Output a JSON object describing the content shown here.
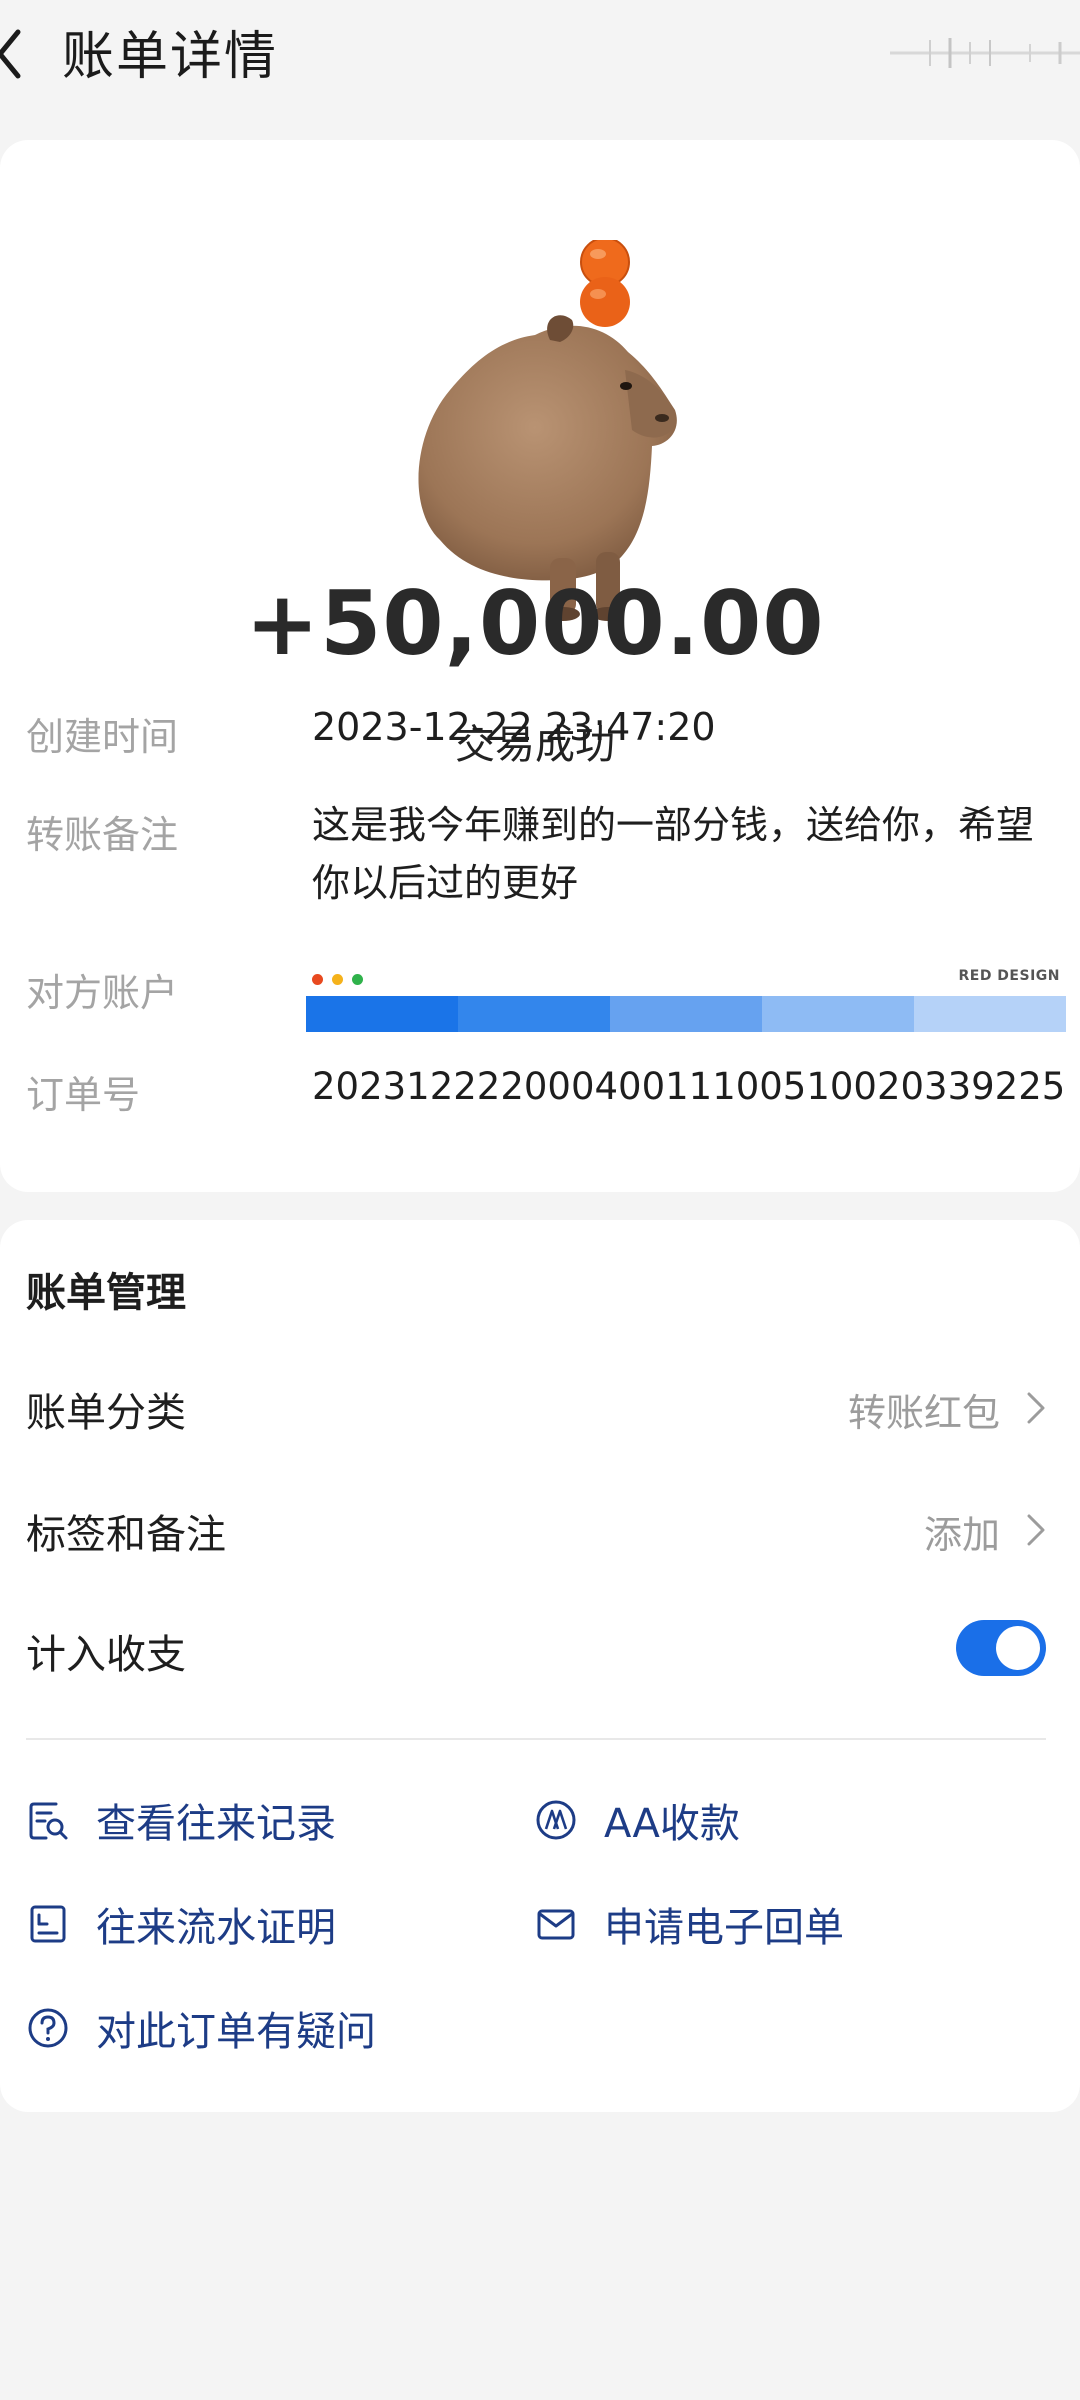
{
  "header": {
    "title": "账单详情",
    "back_icon": "chevron-left-icon"
  },
  "summary": {
    "amount": "+50,000.00",
    "status": "交易成功",
    "fields": [
      {
        "label": "创建时间",
        "value": "2023-12-22 23:47:20"
      },
      {
        "label": "转账备注",
        "value": "这是我今年赚到的一部分钱，送给你，希望你以后过的更好"
      },
      {
        "label": "对方账户",
        "value": ""
      },
      {
        "label": "订单号",
        "value": "20231222200040011100510020339225"
      }
    ],
    "account_banner": {
      "brand": "RED DESIGN",
      "dot_colors": [
        "#e8491f",
        "#f5b21b",
        "#2fb24b"
      ],
      "segment_colors": [
        "#1a74e8",
        "#3386ec",
        "#66a2f0",
        "#8ebbf4",
        "#b5d2f8"
      ]
    }
  },
  "management": {
    "title": "账单管理",
    "rows": [
      {
        "label": "账单分类",
        "value": "转账红包"
      },
      {
        "label": "标签和备注",
        "value": "添加"
      },
      {
        "label": "计入收支",
        "toggle_on": true
      }
    ],
    "actions": [
      {
        "label": "查看往来记录",
        "icon": "record-search-icon"
      },
      {
        "label": "AA收款",
        "icon": "aa-collect-icon"
      },
      {
        "label": "往来流水证明",
        "icon": "statement-icon"
      },
      {
        "label": "申请电子回单",
        "icon": "mail-icon"
      },
      {
        "label": "对此订单有疑问",
        "icon": "question-icon"
      }
    ]
  },
  "colors": {
    "accent": "#1a6fe8",
    "action_text": "#1d3c86",
    "muted": "#a4a4a4"
  }
}
